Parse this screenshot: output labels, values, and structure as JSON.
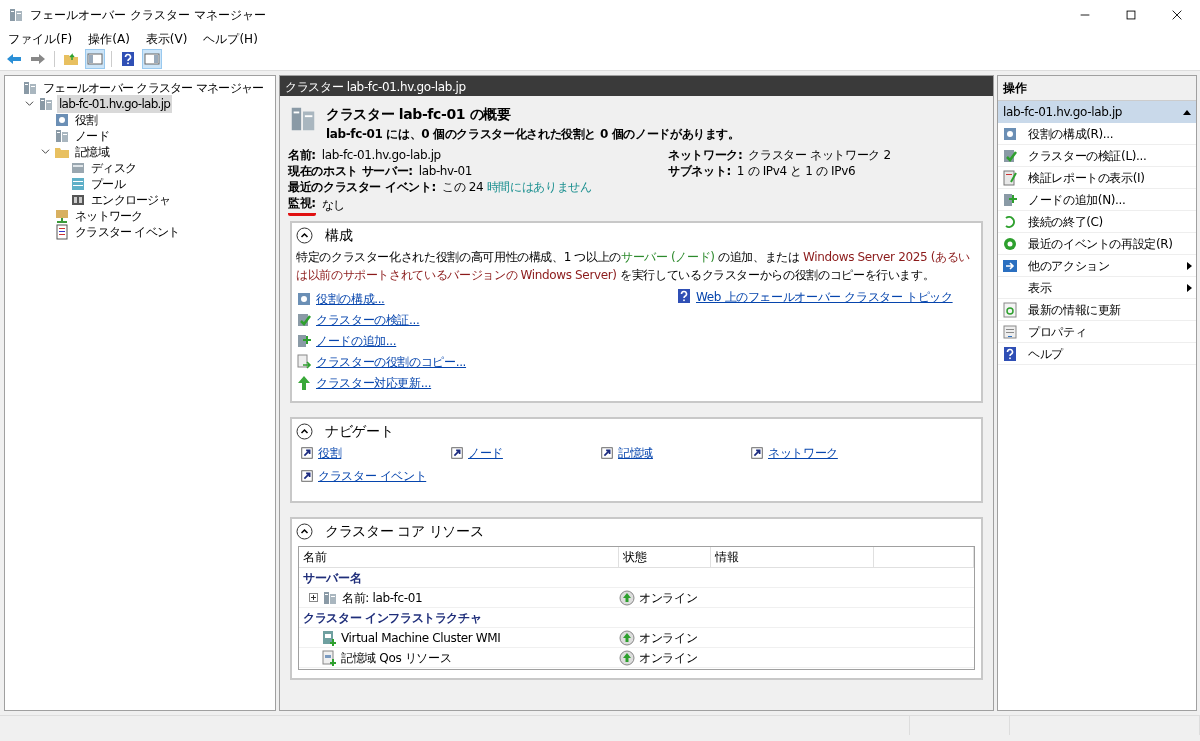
{
  "window": {
    "title": "フェールオーバー クラスター マネージャー"
  },
  "menu": [
    "ファイル(F)",
    "操作(A)",
    "表示(V)",
    "ヘルプ(H)"
  ],
  "tree": {
    "label": "フェールオーバー クラスター マネージャー",
    "children": [
      {
        "label": "lab-fc-01.hv.go-lab.jp",
        "expanded": true,
        "selected": true,
        "children": [
          {
            "label": "役割",
            "selected": false
          },
          {
            "label": "ノード",
            "selected": false
          },
          {
            "label": "記憶域",
            "expanded": true,
            "selected": false,
            "children": [
              {
                "label": "ディスク",
                "selected": false
              },
              {
                "label": "プール",
                "selected": false
              },
              {
                "label": "エンクロージャ",
                "selected": false
              }
            ]
          },
          {
            "label": "ネットワーク",
            "selected": false
          },
          {
            "label": "クラスター イベント",
            "selected": false
          }
        ]
      }
    ]
  },
  "center_header": "クラスター lab-fc-01.hv.go-lab.jp",
  "summary": {
    "title": "クラスター lab-fc-01 の概要",
    "subtitle": "lab-fc-01 には、0 個のクラスター化された役割と 0 個のノードがあります。",
    "fields_left": [
      {
        "label": "名前:",
        "value": [
          {
            "text": "lab-fc-01.hv.go-lab.jp",
            "highlighted": false
          }
        ],
        "annotated": false
      },
      {
        "label": "現在のホスト サーバー:",
        "value": [
          {
            "text": "lab-hv-01",
            "highlighted": false
          }
        ],
        "annotated": false
      },
      {
        "label": "最近のクラスター イベント:",
        "value": [
          {
            "text": "この 24 ",
            "highlighted": false
          },
          {
            "text": "時間にはありません",
            "highlighted": true
          }
        ],
        "annotated": false
      },
      {
        "label": "監視:",
        "value": [
          {
            "text": "なし",
            "highlighted": false
          }
        ],
        "annotated": true
      }
    ],
    "fields_right": [
      {
        "label": "ネットワーク:",
        "value": [
          {
            "text": "クラスター ネットワーク 2",
            "highlighted": false
          }
        ],
        "annotated": false
      },
      {
        "label": "サブネット:",
        "value": [
          {
            "text": "1 の IPv4 と 1 の IPv6",
            "highlighted": false
          }
        ],
        "annotated": false
      }
    ]
  },
  "configure": {
    "title": "構成",
    "expanded": true,
    "description": [
      {
        "text": "特定のクラスター化された役割の高可用性の構成、1 つ以上の",
        "kind": "plain"
      },
      {
        "text": "サーバー (ノード)",
        "kind": "green"
      },
      {
        "text": " の追加、または ",
        "kind": "plain"
      },
      {
        "text": "Windows Server 2025 (あるいは以前のサポートされているバージョンの Windows Server)",
        "kind": "red"
      },
      {
        "text": " を実行しているクラスターからの役割のコピーを行います。",
        "kind": "plain"
      }
    ],
    "links": [
      "役割の構成...",
      "クラスターの検証...",
      "ノードの追加...",
      "クラスターの役割のコピー...",
      "クラスター対応更新..."
    ],
    "web_link": "Web 上のフェールオーバー クラスター トピック"
  },
  "navigate": {
    "title": "ナビゲート",
    "expanded": true,
    "links": [
      "役割",
      "ノード",
      "記憶域",
      "ネットワーク",
      "クラスター イベント"
    ]
  },
  "core_resources": {
    "title": "クラスター コア リソース",
    "expanded": true,
    "columns": [
      "名前",
      "状態",
      "情報"
    ],
    "groups": [
      {
        "name": "サーバー名",
        "rows": [
          {
            "name": "名前: lab-fc-01",
            "status": "オンライン",
            "expandable": true
          }
        ]
      },
      {
        "name": "クラスター インフラストラクチャ",
        "rows": [
          {
            "name": "Virtual Machine Cluster WMI",
            "status": "オンライン",
            "expandable": false
          },
          {
            "name": "記憶域 Qos リソース",
            "status": "オンライン",
            "expandable": false
          }
        ]
      }
    ]
  },
  "actions": {
    "header": "操作",
    "group": "lab-fc-01.hv.go-lab.jp",
    "expanded": true,
    "items": [
      {
        "label": "役割の構成(R)...",
        "submenu": false
      },
      {
        "label": "クラスターの検証(L)...",
        "submenu": false
      },
      {
        "label": "検証レポートの表示(I)",
        "submenu": false
      },
      {
        "label": "ノードの追加(N)...",
        "submenu": false
      },
      {
        "label": "接続の終了(C)",
        "submenu": false
      },
      {
        "label": "最近のイベントの再設定(R)",
        "submenu": false
      },
      {
        "label": "他のアクション",
        "submenu": true
      },
      {
        "label": "表示",
        "submenu": true
      },
      {
        "label": "最新の情報に更新",
        "submenu": false
      },
      {
        "label": "プロパティ",
        "submenu": false
      },
      {
        "label": "ヘルプ",
        "submenu": false
      }
    ]
  }
}
